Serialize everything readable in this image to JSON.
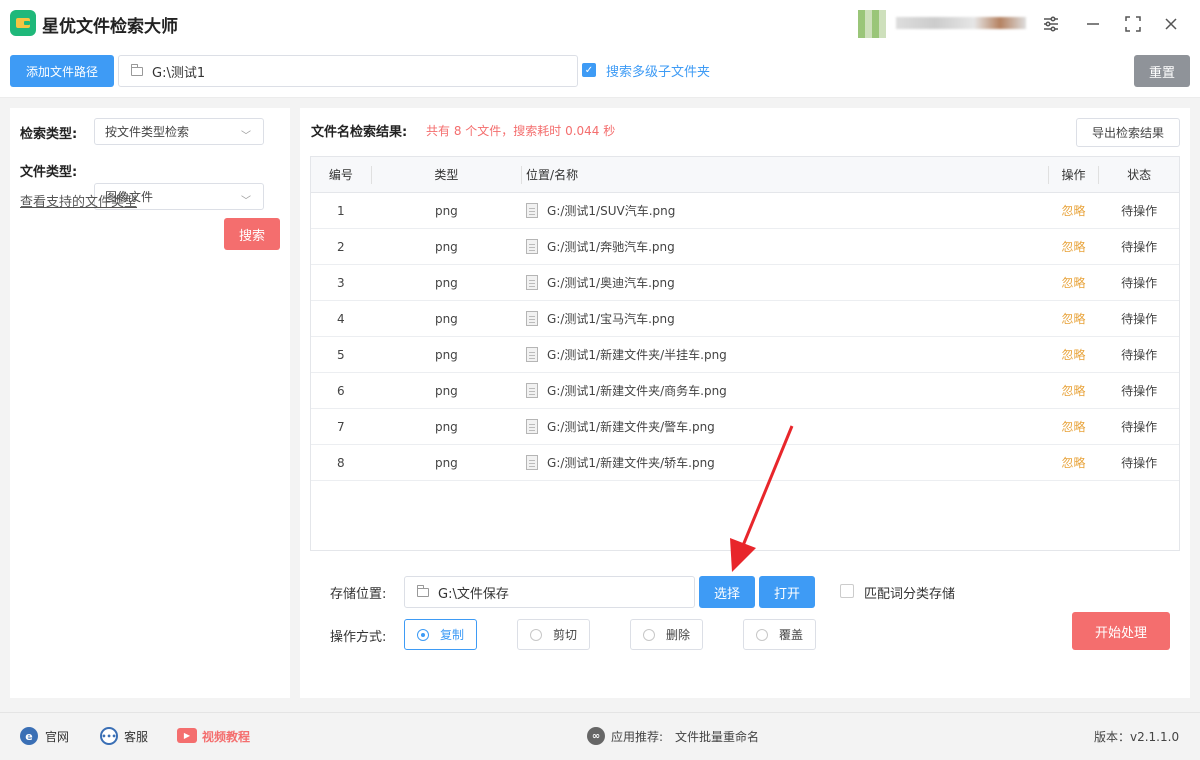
{
  "app": {
    "title": "星优文件检索大师"
  },
  "toolbar": {
    "add_path_label": "添加文件路径",
    "path_value": "G:\\测试1",
    "subfolder_label": "搜索多级子文件夹",
    "subfolder_checked": true,
    "reset_label": "重置"
  },
  "sidebar": {
    "search_type_label": "检索类型:",
    "search_type_value": "按文件类型检索",
    "file_type_label": "文件类型:",
    "file_type_value": "图像文件",
    "supported_link": "查看支持的文件类型",
    "search_button": "搜索"
  },
  "results": {
    "title": "文件名检索结果:",
    "summary": "共有 8 个文件，搜索耗时 0.044 秒",
    "export_label": "导出检索结果",
    "columns": {
      "no": "编号",
      "type": "类型",
      "path": "位置/名称",
      "op": "操作",
      "status": "状态"
    },
    "rows": [
      {
        "no": "1",
        "type": "png",
        "path": "G:/测试1/SUV汽车.png",
        "op": "忽略",
        "status": "待操作"
      },
      {
        "no": "2",
        "type": "png",
        "path": "G:/测试1/奔驰汽车.png",
        "op": "忽略",
        "status": "待操作"
      },
      {
        "no": "3",
        "type": "png",
        "path": "G:/测试1/奥迪汽车.png",
        "op": "忽略",
        "status": "待操作"
      },
      {
        "no": "4",
        "type": "png",
        "path": "G:/测试1/宝马汽车.png",
        "op": "忽略",
        "status": "待操作"
      },
      {
        "no": "5",
        "type": "png",
        "path": "G:/测试1/新建文件夹/半挂车.png",
        "op": "忽略",
        "status": "待操作"
      },
      {
        "no": "6",
        "type": "png",
        "path": "G:/测试1/新建文件夹/商务车.png",
        "op": "忽略",
        "status": "待操作"
      },
      {
        "no": "7",
        "type": "png",
        "path": "G:/测试1/新建文件夹/警车.png",
        "op": "忽略",
        "status": "待操作"
      },
      {
        "no": "8",
        "type": "png",
        "path": "G:/测试1/新建文件夹/轿车.png",
        "op": "忽略",
        "status": "待操作"
      }
    ]
  },
  "storage": {
    "label": "存储位置:",
    "path_value": "G:\\文件保存",
    "choose_label": "选择",
    "open_label": "打开",
    "match_label": "匹配词分类存储",
    "match_checked": false
  },
  "operation": {
    "label": "操作方式:",
    "options": [
      "复制",
      "剪切",
      "删除",
      "覆盖"
    ],
    "selected": "复制",
    "start_label": "开始处理"
  },
  "footer": {
    "website": "官网",
    "service": "客服",
    "video": "视频教程",
    "recommend_label": "应用推荐:",
    "recommend_app": "文件批量重命名",
    "version": "版本：v2.1.1.0"
  },
  "colors": {
    "primary": "#3e9bf5",
    "danger": "#f46e6e",
    "ignore": "#e8a33a",
    "summary": "#f46e6e",
    "arrow": "#e8262b"
  }
}
